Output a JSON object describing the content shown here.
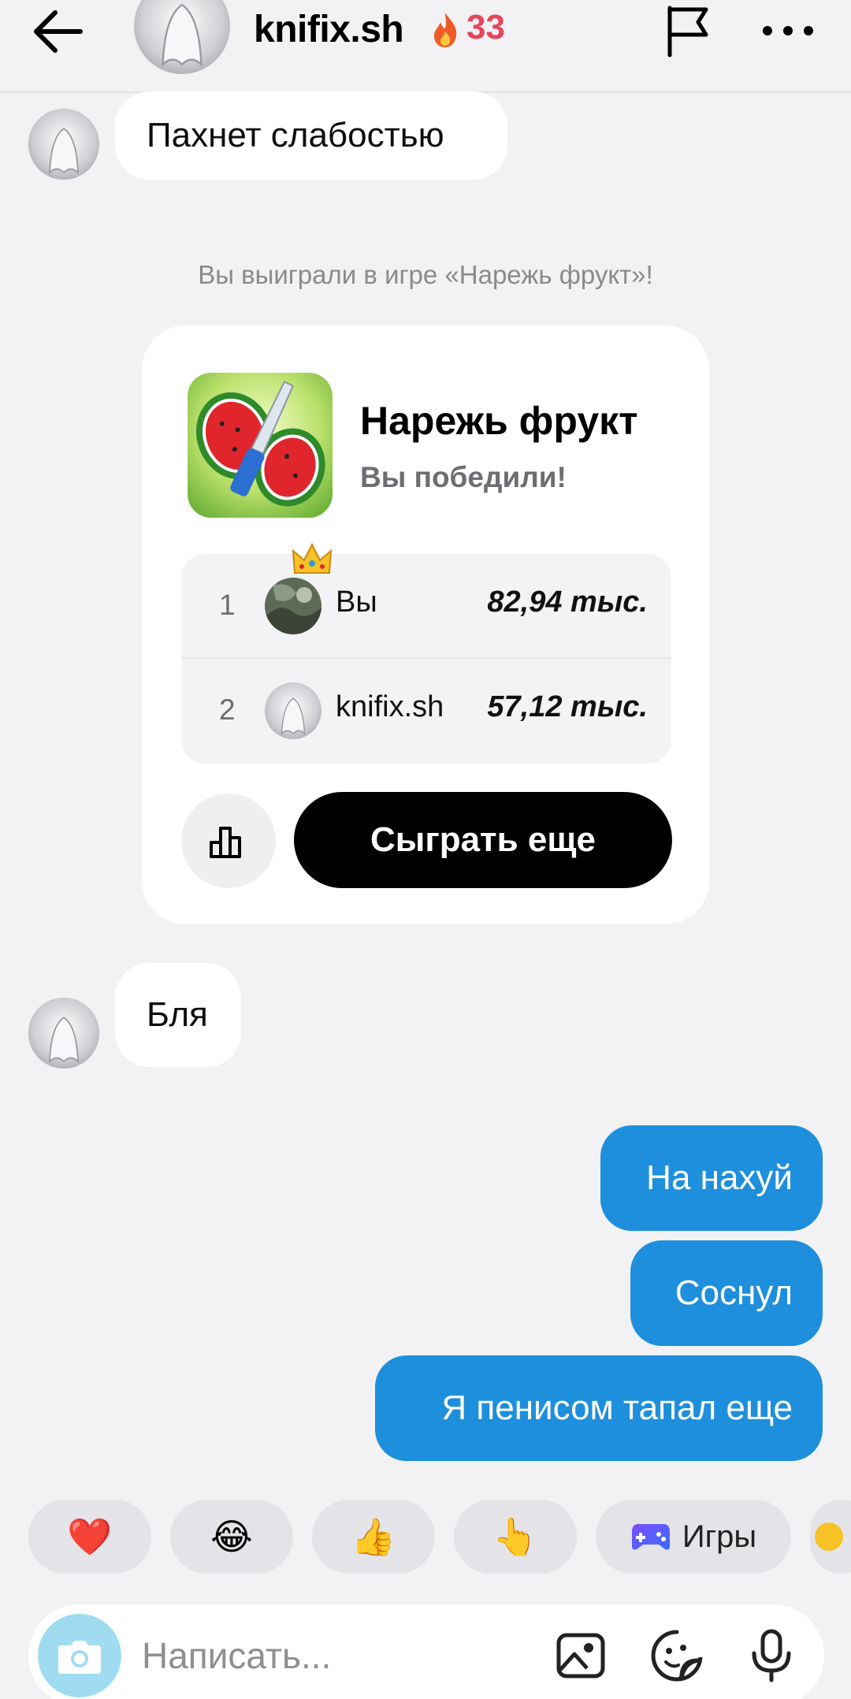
{
  "header": {
    "username": "knifix.sh",
    "streak_count": "33",
    "streak_icon": "fire-icon",
    "back_icon": "arrow-left-icon",
    "flag_icon": "flag-icon",
    "more_icon": "more-horizontal-icon"
  },
  "messages": [
    {
      "side": "in",
      "text": "Пахнет слабостью"
    },
    {
      "side": "in",
      "text": "Бля"
    },
    {
      "side": "out",
      "text": "На нахуй"
    },
    {
      "side": "out",
      "text": "Соснул"
    },
    {
      "side": "out",
      "text": "Я пенисом тапал еще"
    }
  ],
  "system_message": "Вы выиграли в игре «Нарежь фрукт»!",
  "game_card": {
    "title": "Нарежь фрукт",
    "subtitle": "Вы победили!",
    "leaderboard": [
      {
        "rank": "1",
        "name": "Вы",
        "score": "82,94 тыс.",
        "crown": true
      },
      {
        "rank": "2",
        "name": "knifix.sh",
        "score": "57,12 тыс.",
        "crown": false
      }
    ],
    "play_again_label": "Сыграть еще",
    "leaderboard_icon": "leaderboard-icon"
  },
  "reactions": [
    {
      "emoji": "❤️",
      "name": "heart"
    },
    {
      "emoji": "😂",
      "name": "laughing"
    },
    {
      "emoji": "👍",
      "name": "thumbs-up"
    },
    {
      "emoji": "👆",
      "name": "pointing-up"
    }
  ],
  "games_chip": {
    "label": "Игры",
    "icon": "gamepad-icon"
  },
  "composer": {
    "placeholder": "Написать...",
    "camera_icon": "camera-icon",
    "gallery_icon": "image-icon",
    "sticker_icon": "sticker-icon",
    "mic_icon": "microphone-icon"
  },
  "colors": {
    "outgoing_bubble": "#1e8fdc",
    "streak": "#e8445a",
    "background": "#f2f2f4",
    "play_button": "#000000"
  }
}
